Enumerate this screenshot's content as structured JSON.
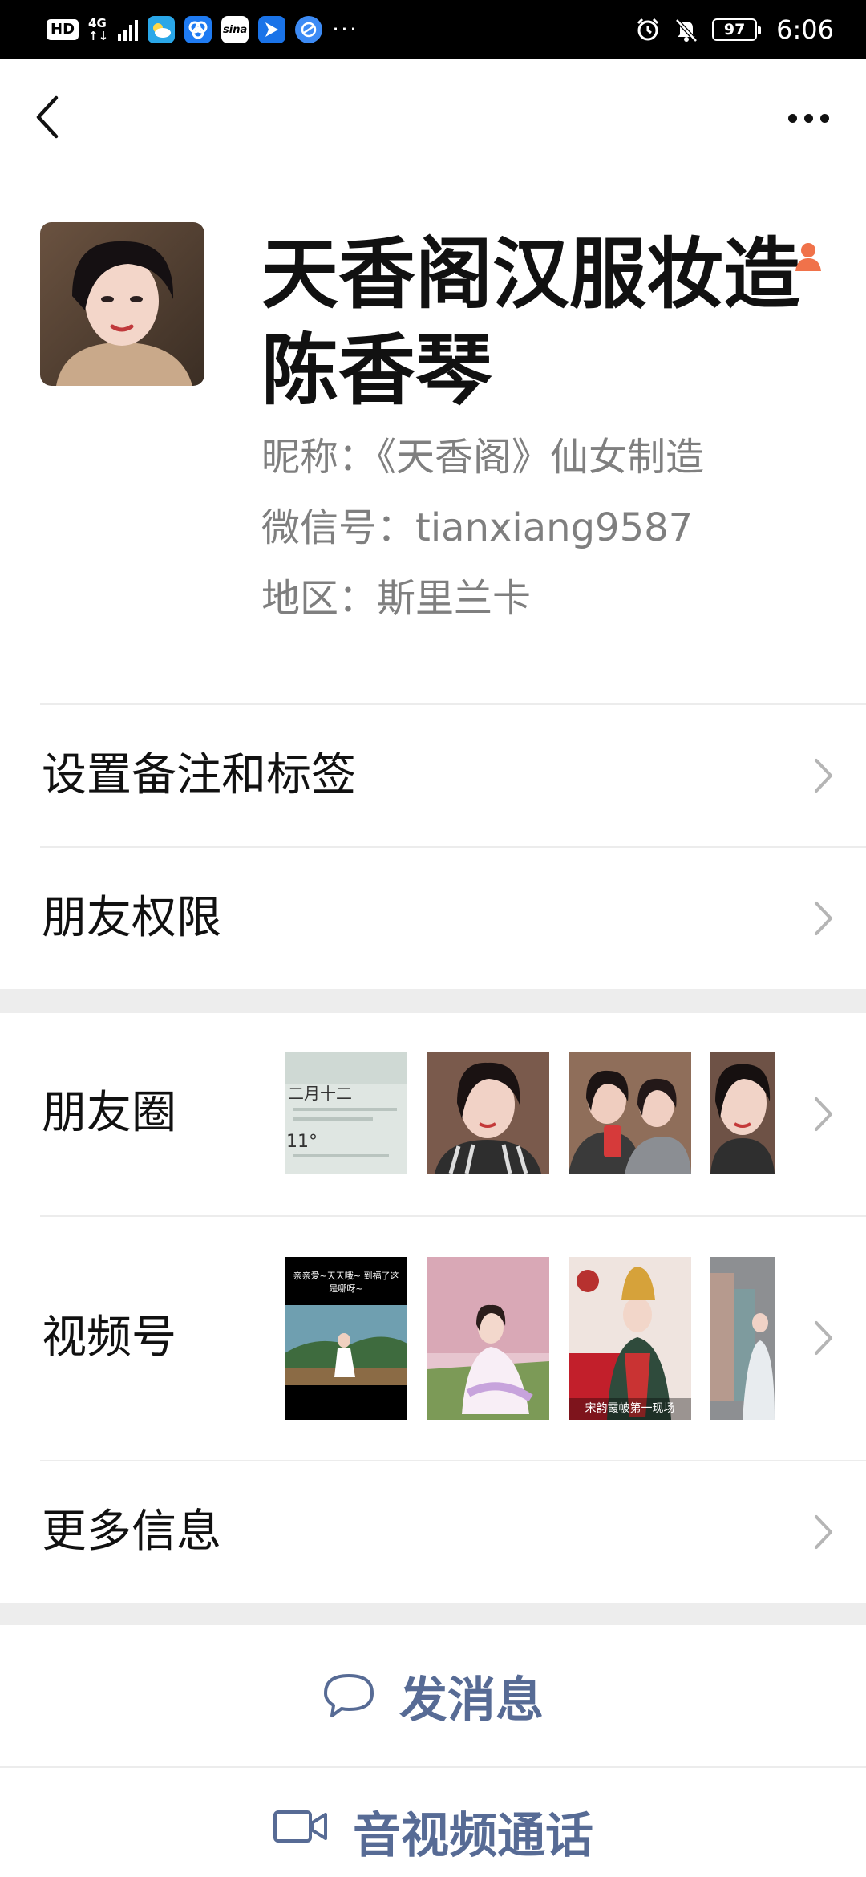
{
  "status_bar": {
    "hd": "HD",
    "net_top": "4G",
    "net_bottom": "↑↓",
    "app_icons": [
      "weather-icon",
      "ring-app-icon",
      "sina-icon",
      "message-arrow-icon",
      "browser-icon"
    ],
    "sina_text": "sina",
    "overflow": "···",
    "battery": "97",
    "time": "6:06"
  },
  "profile": {
    "name": "天香阁汉服妆造陈香琴",
    "nickname": "昵称：《天香阁》仙女制造",
    "wechat_id": "微信号：tianxiang9587",
    "region": "地区：斯里兰卡"
  },
  "rows": {
    "remark": "设置备注和标签",
    "permission": "朋友权限",
    "moments": "朋友圈",
    "channels": "视频号",
    "more_info": "更多信息"
  },
  "thumbs": {
    "moments_weather_date": "二月十二",
    "moments_weather_temp": "11°",
    "channel_1_caption": "亲亲爱~天天哦~ 到福了这是哪呀~",
    "channel_3_caption": "宋韵霞帔第一现场"
  },
  "actions": {
    "message": "发消息",
    "call": "音视频通话"
  },
  "colors": {
    "link_blue": "#576b95",
    "secondary_text": "#7f7f7f",
    "badge_orange": "#f0724a"
  }
}
